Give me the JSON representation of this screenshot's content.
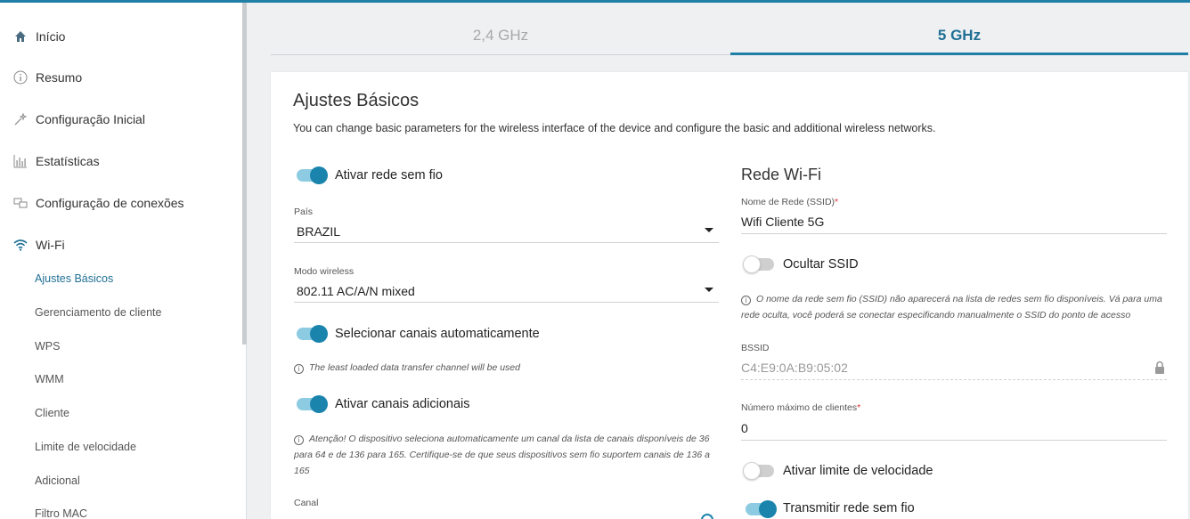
{
  "sidebar": {
    "items": [
      {
        "label": "Início",
        "icon": "home-icon"
      },
      {
        "label": "Resumo",
        "icon": "info-icon"
      },
      {
        "label": "Configuração Inicial",
        "icon": "wand-icon"
      },
      {
        "label": "Estatísticas",
        "icon": "bar-chart-icon"
      },
      {
        "label": "Configuração de conexões",
        "icon": "connections-icon"
      },
      {
        "label": "Wi-Fi",
        "icon": "wifi-icon"
      }
    ],
    "wifi_subitems": [
      {
        "label": "Ajustes Básicos",
        "active": true
      },
      {
        "label": "Gerenciamento de cliente"
      },
      {
        "label": "WPS"
      },
      {
        "label": "WMM"
      },
      {
        "label": "Cliente"
      },
      {
        "label": "Limite de velocidade"
      },
      {
        "label": "Adicional"
      },
      {
        "label": "Filtro MAC"
      }
    ]
  },
  "tabs": [
    {
      "label": "2,4 GHz",
      "active": false
    },
    {
      "label": "5 GHz",
      "active": true
    }
  ],
  "page": {
    "title": "Ajustes Básicos",
    "description": "You can change basic parameters for the wireless interface of the device and configure the basic and additional wireless networks."
  },
  "left": {
    "enable_wireless": {
      "label": "Ativar rede sem fio",
      "on": true
    },
    "country": {
      "label": "País",
      "value": "BRAZIL"
    },
    "wireless_mode": {
      "label": "Modo wireless",
      "value": "802.11 AC/A/N mixed"
    },
    "auto_channels": {
      "label": "Selecionar canais automaticamente",
      "on": true,
      "hint": "The least loaded data transfer channel will be used"
    },
    "additional_channels": {
      "label": "Ativar canais adicionais",
      "on": true,
      "hint": "Atenção! O dispositivo seleciona automaticamente um canal da lista de canais disponíveis de 36 para 64 e de 136 para 165. Certifique-se de que seus dispositivos sem fio suportem canais de 136 a 165"
    },
    "channel": {
      "label": "Canal"
    }
  },
  "right": {
    "title": "Rede Wi-Fi",
    "ssid": {
      "label": "Nome de Rede (SSID)",
      "required": "*",
      "value": "Wifi Cliente 5G"
    },
    "hide_ssid": {
      "label": "Ocultar SSID",
      "on": false,
      "hint": "O nome da rede sem fio (SSID) não aparecerá na lista de redes sem fio disponíveis. Vá para uma rede oculta, você poderá se conectar especificando manualmente o SSID do ponto de acesso"
    },
    "bssid": {
      "label": "BSSID",
      "value": "C4:E9:0A:B9:05:02",
      "icon": "lock-icon"
    },
    "max_clients": {
      "label": "Número máximo de clientes",
      "required": "*",
      "value": "0"
    },
    "speed_limit": {
      "label": "Ativar limite de velocidade",
      "on": false
    },
    "broadcast": {
      "label": "Transmitir rede sem fio",
      "on": true
    }
  },
  "colors": {
    "accent": "#1f7fa6",
    "toggle_on": "#1a84ad",
    "toggle_track": "#8ccbe1"
  }
}
